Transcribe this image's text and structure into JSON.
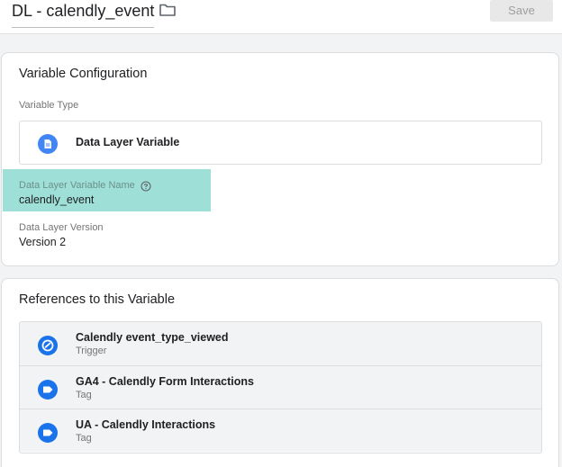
{
  "header": {
    "title": "DL - calendly_event",
    "save_label": "Save"
  },
  "config": {
    "heading": "Variable Configuration",
    "type_label": "Variable Type",
    "type_value": "Data Layer Variable",
    "name_label": "Data Layer Variable Name",
    "name_value": "calendly_event",
    "version_label": "Data Layer Version",
    "version_value": "Version 2",
    "highlight_color": "#9ee0d7"
  },
  "references": {
    "heading": "References to this Variable",
    "items": [
      {
        "name": "Calendly event_type_viewed",
        "kind": "Trigger",
        "icon": "trigger-icon"
      },
      {
        "name": "GA4 - Calendly Form Interactions",
        "kind": "Tag",
        "icon": "tag-icon"
      },
      {
        "name": "UA - Calendly Interactions",
        "kind": "Tag",
        "icon": "tag-icon"
      }
    ]
  },
  "colors": {
    "accent": "#1a73e8",
    "variable_icon": "#4285f4"
  }
}
